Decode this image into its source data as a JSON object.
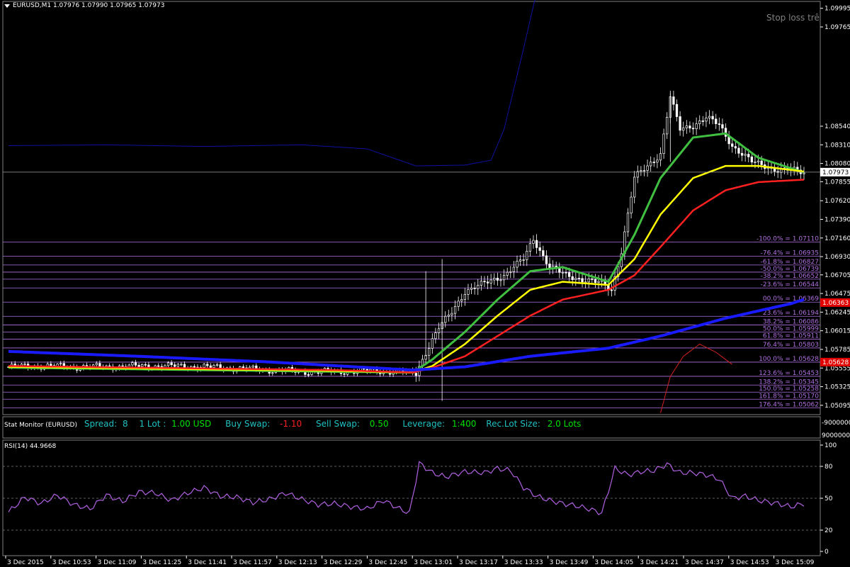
{
  "header": {
    "symbol_line": "EURUSD,M1  1.07976 1.07990 1.07965 1.07973"
  },
  "annotation": {
    "stop_loss_text": "Stop loss trê"
  },
  "current_price": {
    "label": "1.07973",
    "value": 1.07973
  },
  "red_price": {
    "label": "1.06363",
    "value": 1.06363
  },
  "red_price2": {
    "label": "1.05628",
    "value": 1.05628
  },
  "stat_monitor": {
    "title": "Stat Monitor (EURUSD)",
    "spread_label": "Spread:",
    "spread_value": "8",
    "lot_label": "1 Lot :",
    "lot_value": "1.00 USD",
    "buyswap_label": "Buy Swap:",
    "buyswap_value": "-1.10",
    "sellswap_label": "Sell Swap:",
    "sellswap_value": "0.50",
    "leverage_label": "Leverage:",
    "leverage_value": "1:400",
    "reclot_label": "Rec.Lot Size:",
    "reclot_value": "2.0 Lots",
    "scale_top": "-9000000",
    "scale_bottom": "90000000"
  },
  "rsi": {
    "label": "RSI(14) 44.9668",
    "levels": [
      80,
      50,
      20
    ],
    "scale": [
      "100",
      "80",
      "50",
      "20",
      "0"
    ]
  },
  "colors": {
    "background": "#000000",
    "grid_text": "#ffffff",
    "fib": "#b070e0",
    "rsi": "#b060e0",
    "ema_green": "#40c040",
    "ema_yellow": "#ffff00",
    "ema_red": "#ff2020",
    "ma_blue": "#1a1aff",
    "dark_blue": "#1010a0",
    "sell_green": "#00e000",
    "buy_red": "#ff2020"
  },
  "chart_data": {
    "type": "candlestick",
    "symbol": "EURUSD",
    "timeframe": "M1",
    "ohlc_last": {
      "open": 1.07976,
      "high": 1.0799,
      "low": 1.07965,
      "close": 1.07973
    },
    "ylim": [
      1.0498,
      1.1008
    ],
    "y_ticks": [
      "1.09995",
      "1.09765",
      "1.08540",
      "1.08310",
      "1.08080",
      "1.07855",
      "1.07620",
      "1.07390",
      "1.07160",
      "1.06930",
      "1.06705",
      "1.06475",
      "1.06245",
      "1.06015",
      "1.05785",
      "1.05555",
      "1.05325",
      "1.05095"
    ],
    "x_ticks": [
      "3 Dec 2015",
      "3 Dec 10:53",
      "3 Dec 11:09",
      "3 Dec 11:25",
      "3 Dec 11:41",
      "3 Dec 11:57",
      "3 Dec 12:13",
      "3 Dec 12:29",
      "3 Dec 12:45",
      "3 Dec 13:01",
      "3 Dec 13:17",
      "3 Dec 13:33",
      "3 Dec 13:49",
      "3 Dec 14:05",
      "3 Dec 14:21",
      "3 Dec 14:37",
      "3 Dec 14:53",
      "3 Dec 15:09"
    ],
    "fib_levels": [
      {
        "label": "-100.0% = 1.07110",
        "value": 1.0711
      },
      {
        "label": "-76.4% = 1.06935",
        "value": 1.06935
      },
      {
        "label": "-61.8% = 1.06827",
        "value": 1.06827
      },
      {
        "label": "-50.0% = 1.06739",
        "value": 1.06739
      },
      {
        "label": "-38.2% = 1.06652",
        "value": 1.06652
      },
      {
        "label": "-23.6% = 1.06544",
        "value": 1.06544
      },
      {
        "label": "00.0% = 1.06369",
        "value": 1.06369
      },
      {
        "label": "23.6% = 1.06194",
        "value": 1.06194
      },
      {
        "label": "38.2% = 1.06086",
        "value": 1.06086
      },
      {
        "label": "50.0% = 1.05999",
        "value": 1.05999
      },
      {
        "label": "61.8% = 1.05911",
        "value": 1.05911
      },
      {
        "label": "76.4% = 1.05803",
        "value": 1.05803
      },
      {
        "label": "100.0% = 1.05628",
        "value": 1.05628
      },
      {
        "label": "123.6% = 1.05453",
        "value": 1.05453
      },
      {
        "label": "138.2% = 1.05345",
        "value": 1.05345
      },
      {
        "label": "150.0% = 1.05258",
        "value": 1.05258
      },
      {
        "label": "161.8% = 1.05170",
        "value": 1.0517
      },
      {
        "label": "176.4% = 1.05062",
        "value": 1.05062
      }
    ],
    "price_keys": [
      [
        0,
        1.0557
      ],
      [
        10,
        1.0558
      ],
      [
        20,
        1.0557
      ],
      [
        30,
        1.0557
      ],
      [
        40,
        1.0558
      ],
      [
        50,
        1.0558
      ],
      [
        60,
        1.0557
      ],
      [
        70,
        1.0555
      ],
      [
        80,
        1.0553
      ],
      [
        90,
        1.0551
      ],
      [
        100,
        1.0551
      ],
      [
        110,
        1.0552
      ],
      [
        120,
        1.0551
      ],
      [
        125,
        1.0549
      ],
      [
        128,
        1.0575
      ],
      [
        132,
        1.0605
      ],
      [
        136,
        1.0625
      ],
      [
        140,
        1.065
      ],
      [
        146,
        1.066
      ],
      [
        152,
        1.067
      ],
      [
        158,
        1.069
      ],
      [
        161,
        1.0715
      ],
      [
        166,
        1.068
      ],
      [
        171,
        1.067
      ],
      [
        176,
        1.0665
      ],
      [
        182,
        1.066
      ],
      [
        185,
        1.0652
      ],
      [
        188,
        1.07
      ],
      [
        192,
        1.079
      ],
      [
        196,
        1.0805
      ],
      [
        200,
        1.082
      ],
      [
        203,
        1.089
      ],
      [
        206,
        1.085
      ],
      [
        210,
        1.0855
      ],
      [
        214,
        1.0865
      ],
      [
        218,
        1.0855
      ],
      [
        222,
        1.083
      ],
      [
        228,
        1.081
      ],
      [
        232,
        1.0805
      ],
      [
        236,
        1.08
      ],
      [
        240,
        1.08
      ],
      [
        244,
        1.0797
      ]
    ],
    "series": [
      {
        "name": "EMA green",
        "values": [
          [
            0,
            1.0556
          ],
          [
            100,
            1.0551
          ],
          [
            124,
            1.055
          ],
          [
            130,
            1.0566
          ],
          [
            140,
            1.06
          ],
          [
            150,
            1.064
          ],
          [
            160,
            1.0675
          ],
          [
            170,
            1.068
          ],
          [
            184,
            1.0662
          ],
          [
            192,
            1.072
          ],
          [
            200,
            1.079
          ],
          [
            210,
            1.084
          ],
          [
            220,
            1.0845
          ],
          [
            230,
            1.0815
          ],
          [
            244,
            1.0797
          ]
        ]
      },
      {
        "name": "EMA yellow",
        "values": [
          [
            0,
            1.0557
          ],
          [
            100,
            1.0552
          ],
          [
            124,
            1.055
          ],
          [
            130,
            1.0558
          ],
          [
            140,
            1.0585
          ],
          [
            150,
            1.062
          ],
          [
            160,
            1.0652
          ],
          [
            170,
            1.0662
          ],
          [
            184,
            1.0658
          ],
          [
            192,
            1.069
          ],
          [
            200,
            1.0745
          ],
          [
            210,
            1.079
          ],
          [
            220,
            1.0805
          ],
          [
            230,
            1.0805
          ],
          [
            244,
            1.0798
          ]
        ]
      },
      {
        "name": "EMA red",
        "values": [
          [
            0,
            1.0558
          ],
          [
            100,
            1.0553
          ],
          [
            124,
            1.055
          ],
          [
            130,
            1.0556
          ],
          [
            140,
            1.057
          ],
          [
            150,
            1.0595
          ],
          [
            160,
            1.062
          ],
          [
            170,
            1.064
          ],
          [
            184,
            1.0652
          ],
          [
            192,
            1.067
          ],
          [
            200,
            1.0705
          ],
          [
            210,
            1.075
          ],
          [
            220,
            1.0775
          ],
          [
            230,
            1.0785
          ],
          [
            244,
            1.0788
          ]
        ]
      },
      {
        "name": "MA blue",
        "values": [
          [
            0,
            1.0576
          ],
          [
            40,
            1.057
          ],
          [
            80,
            1.0563
          ],
          [
            124,
            1.0553
          ],
          [
            140,
            1.0557
          ],
          [
            160,
            1.057
          ],
          [
            184,
            1.058
          ],
          [
            200,
            1.0595
          ],
          [
            220,
            1.0617
          ],
          [
            240,
            1.0635
          ],
          [
            244,
            1.064
          ]
        ]
      }
    ],
    "rsi_series": [
      [
        0,
        37
      ],
      [
        5,
        51
      ],
      [
        10,
        45
      ],
      [
        15,
        53
      ],
      [
        20,
        44
      ],
      [
        25,
        40
      ],
      [
        30,
        53
      ],
      [
        35,
        47
      ],
      [
        40,
        56
      ],
      [
        45,
        55
      ],
      [
        50,
        48
      ],
      [
        55,
        55
      ],
      [
        60,
        60
      ],
      [
        65,
        52
      ],
      [
        70,
        51
      ],
      [
        75,
        46
      ],
      [
        80,
        49
      ],
      [
        85,
        55
      ],
      [
        90,
        49
      ],
      [
        95,
        44
      ],
      [
        100,
        45
      ],
      [
        105,
        42
      ],
      [
        110,
        40
      ],
      [
        115,
        48
      ],
      [
        120,
        40
      ],
      [
        123,
        36
      ],
      [
        126,
        83
      ],
      [
        130,
        74
      ],
      [
        134,
        70
      ],
      [
        140,
        75
      ],
      [
        146,
        74
      ],
      [
        150,
        78
      ],
      [
        154,
        76
      ],
      [
        158,
        60
      ],
      [
        162,
        52
      ],
      [
        166,
        48
      ],
      [
        170,
        45
      ],
      [
        174,
        43
      ],
      [
        178,
        40
      ],
      [
        182,
        36
      ],
      [
        186,
        78
      ],
      [
        190,
        72
      ],
      [
        194,
        75
      ],
      [
        198,
        76
      ],
      [
        202,
        82
      ],
      [
        206,
        74
      ],
      [
        210,
        74
      ],
      [
        214,
        72
      ],
      [
        218,
        68
      ],
      [
        222,
        50
      ],
      [
        226,
        52
      ],
      [
        230,
        48
      ],
      [
        236,
        45
      ],
      [
        240,
        42
      ],
      [
        244,
        45
      ]
    ]
  }
}
